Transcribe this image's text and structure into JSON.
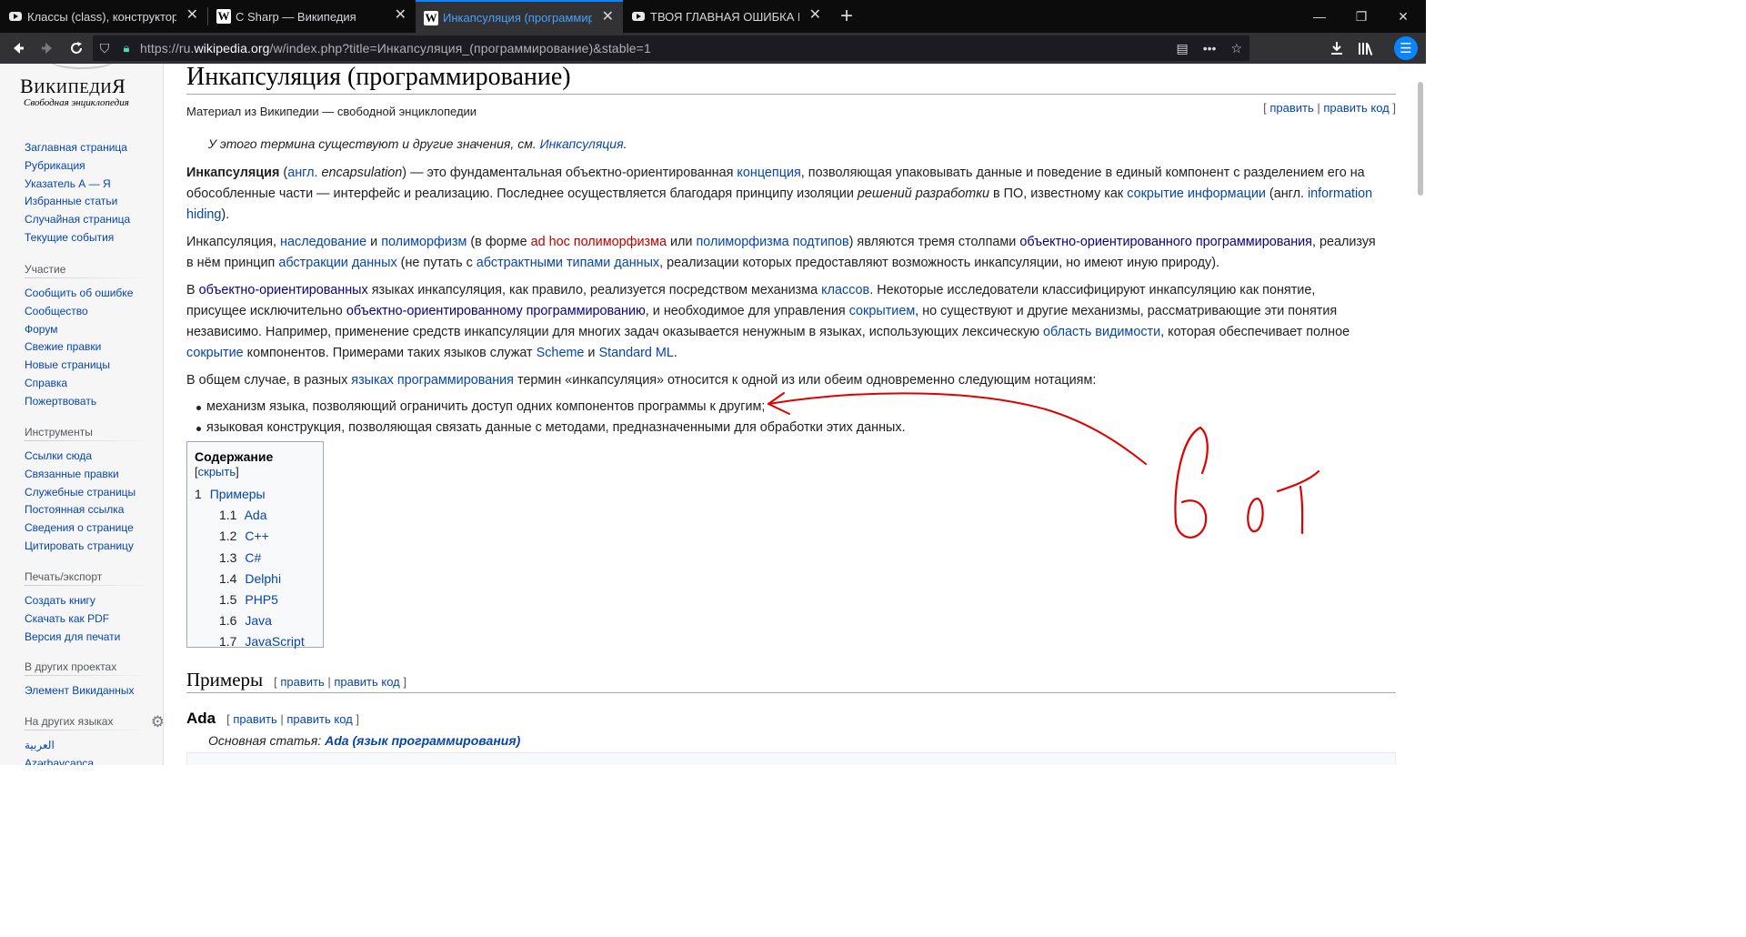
{
  "browser": {
    "tabs": [
      {
        "title": "Классы (class), конструкторы",
        "icon": "youtube-icon"
      },
      {
        "title": "C Sharp — Википедия",
        "icon": "wikipedia-icon"
      },
      {
        "title": "Инкапсуляция (программирование)",
        "icon": "wikipedia-icon",
        "active": true
      },
      {
        "title": "ТВОЯ ГЛАВНАЯ ОШИБКА В ООП",
        "icon": "youtube-icon"
      }
    ],
    "url_prefix": "https://ru.",
    "url_domain": "wikipedia.org",
    "url_rest": "/w/index.php?title=Инкапсуляция_(программирование)&stable=1"
  },
  "logo": {
    "word_cap_1": "В",
    "word_1": "ИКИПЕДИ",
    "word_cap_2": "Я",
    "tagline": "Свободная энциклопедия"
  },
  "sidebar": {
    "nav": [
      "Заглавная страница",
      "Рубрикация",
      "Указатель А — Я",
      "Избранные статьи",
      "Случайная страница",
      "Текущие события"
    ],
    "participation": {
      "title": "Участие",
      "items": [
        "Сообщить об ошибке",
        "Сообщество",
        "Форум",
        "Свежие правки",
        "Новые страницы",
        "Справка",
        "Пожертвовать"
      ]
    },
    "tools": {
      "title": "Инструменты",
      "items": [
        "Ссылки сюда",
        "Связанные правки",
        "Служебные страницы",
        "Постоянная ссылка",
        "Сведения о странице",
        "Цитировать страницу"
      ]
    },
    "print": {
      "title": "Печать/экспорт",
      "items": [
        "Создать книгу",
        "Скачать как PDF",
        "Версия для печати"
      ]
    },
    "projects": {
      "title": "В других проектах",
      "items": [
        "Элемент Викиданных"
      ]
    },
    "languages": {
      "title": "На других языках",
      "items": [
        "العربية",
        "Azərbaycanca"
      ]
    }
  },
  "article": {
    "title": "Инкапсуляция (программирование)",
    "site_sub": "Материал из Википедии — свободной энциклопедии",
    "edit": "править",
    "edit_code": "править код",
    "hatnote_text": "У этого термина существуют и другие значения, см. ",
    "hatnote_link": "Инкапсуляция",
    "p1": {
      "bold": "Инкапсуляция",
      "t1": " (",
      "l_lang": "англ.",
      "t2": " ",
      "i_word": "encapsulation",
      "t3": ") — это фундаментальная объектно-ориентированная ",
      "l1": "концепция",
      "t4": ", позволяющая упаковывать данные и поведение в единый компонент с разделением его на обособленные части — интерфейс и реализацию. Последнее осуществляется благодаря принципу изоляции ",
      "i2": "решений разработки",
      "t5": " в ПО, известному как ",
      "l2": "сокрытие информации",
      "t6": " (англ. ",
      "l3": "information hiding",
      "t7": ")."
    },
    "p2": {
      "t1": "Инкапсуляция, ",
      "l1": "наследование",
      "t2": " и ",
      "l2": "полиморфизм",
      "t3": " (в форме ",
      "l3": "ad hoc полиморфизма",
      "t4": " или ",
      "l4": "полиморфизма подтипов",
      "t5": ") являются тремя столпами ",
      "l5": "объектно-ориентированного программирования",
      "t6": ", реализуя в нём принцип ",
      "l6": "абстракции данных",
      "t7": " (не путать с ",
      "l7": "абстрактными типами данных",
      "t8": ", реализации которых предоставляют возможность инкапсуляции, но имеют иную природу)."
    },
    "p3": {
      "t1": "В ",
      "l1": "объектно-ориентированных",
      "t2": " языках инкапсуляция, как правило, реализуется посредством механизма ",
      "l2": "классов",
      "t3": ". Некоторые исследователи классифицируют инкапсуляцию как понятие, присущее исключительно ",
      "l3": "объектно-ориентированному программированию",
      "t4": ", и необходимое для управления ",
      "l4": "сокрытием",
      "t5": ", но существуют и другие механизмы, рассматривающие эти понятия независимо. Например, применение средств инкапсуляции для многих задач оказывается ненужным в языках, использующих лексическую ",
      "l5": "область видимости",
      "t6": ", которая обеспечивает полное ",
      "l6": "сокрытие",
      "t7": " компонентов. Примерами таких языков служат ",
      "l7": "Scheme",
      "t8": " и ",
      "l8": "Standard ML",
      "t9": "."
    },
    "p4": {
      "t1": "В общем случае, в разных ",
      "l1": "языках программирования",
      "t2": " термин «инкапсуляция» относится к одной из или обеим одновременно следующим нотациям:"
    },
    "bullets": [
      "механизм языка, позволяющий ограничить доступ одних компонентов программы к другим;",
      "языковая конструкция, позволяющая связать данные с методами, предназначенными для обработки этих данных."
    ],
    "toc": {
      "title": "Содержание",
      "toggle": "скрыть",
      "items": [
        {
          "num": "1",
          "label": "Примеры"
        },
        {
          "num": "1.1",
          "label": "Ada"
        },
        {
          "num": "1.2",
          "label": "C++"
        },
        {
          "num": "1.3",
          "label": "C#"
        },
        {
          "num": "1.4",
          "label": "Delphi"
        },
        {
          "num": "1.5",
          "label": "PHP5"
        },
        {
          "num": "1.6",
          "label": "Java"
        },
        {
          "num": "1.7",
          "label": "JavaScript"
        }
      ]
    },
    "section_examples": "Примеры",
    "section_ada": "Ada",
    "main_article_prefix": "Основная статья: ",
    "main_article_link": "Ada (язык программирования)"
  },
  "colors": {
    "link": "#0645ad",
    "visited": "#0b0080",
    "new": "#ba0000",
    "annotation": "#e00000"
  }
}
